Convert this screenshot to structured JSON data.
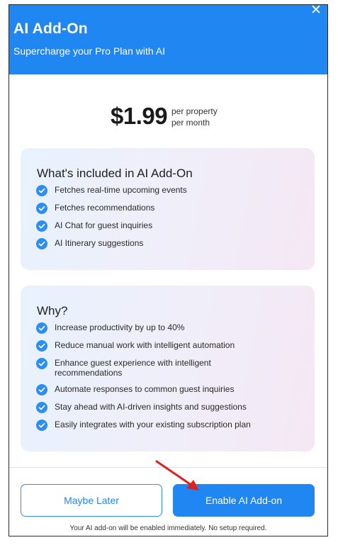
{
  "header": {
    "title": "AI Add-On",
    "subtitle": "Supercharge your Pro Plan with AI",
    "close_glyph": "✕"
  },
  "pricing": {
    "amount": "$1.99",
    "unit_line1": "per property",
    "unit_line2": "per month"
  },
  "included": {
    "heading": "What's included in AI Add-On",
    "items": [
      "Fetches real-time upcoming events",
      "Fetches recommendations",
      "AI Chat for guest inquiries",
      "AI Itinerary suggestions"
    ]
  },
  "why": {
    "heading": "Why?",
    "items": [
      "Increase productivity by up to 40%",
      "Reduce manual work with intelligent automation",
      "Enhance guest experience with intelligent recommendations",
      "Automate responses to common guest inquiries",
      "Stay ahead with AI-driven insights and suggestions",
      "Easily integrates with your existing subscription plan"
    ]
  },
  "footer": {
    "later_label": "Maybe Later",
    "enable_label": "Enable AI Add-on",
    "note": "Your AI add-on will be enabled immediately. No setup required."
  },
  "colors": {
    "brand_blue": "#1f86f2",
    "check_blue": "#2b8ef0",
    "annotation_red": "#e0201c"
  },
  "icons": {
    "check": "check-circle-icon",
    "close": "close-icon",
    "annotation": "red-arrow-annotation"
  }
}
